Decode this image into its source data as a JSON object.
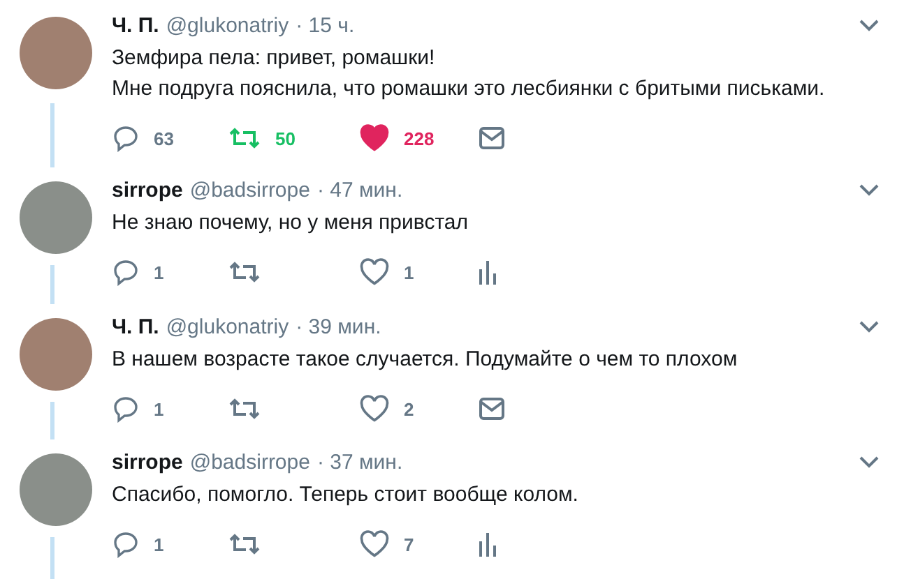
{
  "tweets": [
    {
      "name": "Ч. П.",
      "handle": "@glukonatriy",
      "time": "· 15 ч.",
      "text": [
        "Земфира пела: привет, ромашки!",
        "Мне подруга пояснила, что ромашки это лесбиянки с бритыми письками."
      ],
      "reply_count": "63",
      "retweet_count": "50",
      "retweeted": true,
      "like_count": "228",
      "liked": true,
      "extra_action": {
        "kind": "mail"
      },
      "thread_below": true
    },
    {
      "name": "sirrope",
      "handle": "@badsirrope",
      "time": "· 47 мин.",
      "text": [
        "Не знаю почему, но у меня привстал"
      ],
      "reply_count": "1",
      "retweeted": false,
      "like_count": "1",
      "liked": false,
      "extra_action": {
        "kind": "analytics"
      },
      "thread_below": true
    },
    {
      "name": "Ч. П.",
      "handle": "@glukonatriy",
      "time": "· 39 мин.",
      "text": [
        "В нашем возрасте такое случается. Подумайте о чем то плохом"
      ],
      "reply_count": "1",
      "retweeted": false,
      "like_count": "2",
      "liked": false,
      "extra_action": {
        "kind": "mail"
      },
      "thread_below": true
    },
    {
      "name": "sirrope",
      "handle": "@badsirrope",
      "time": "· 37 мин.",
      "text": [
        "Спасибо, помогло. Теперь стоит вообще колом."
      ],
      "reply_count": "1",
      "retweeted": false,
      "like_count": "7",
      "liked": false,
      "extra_action": {
        "kind": "analytics"
      },
      "thread_below": true
    }
  ]
}
